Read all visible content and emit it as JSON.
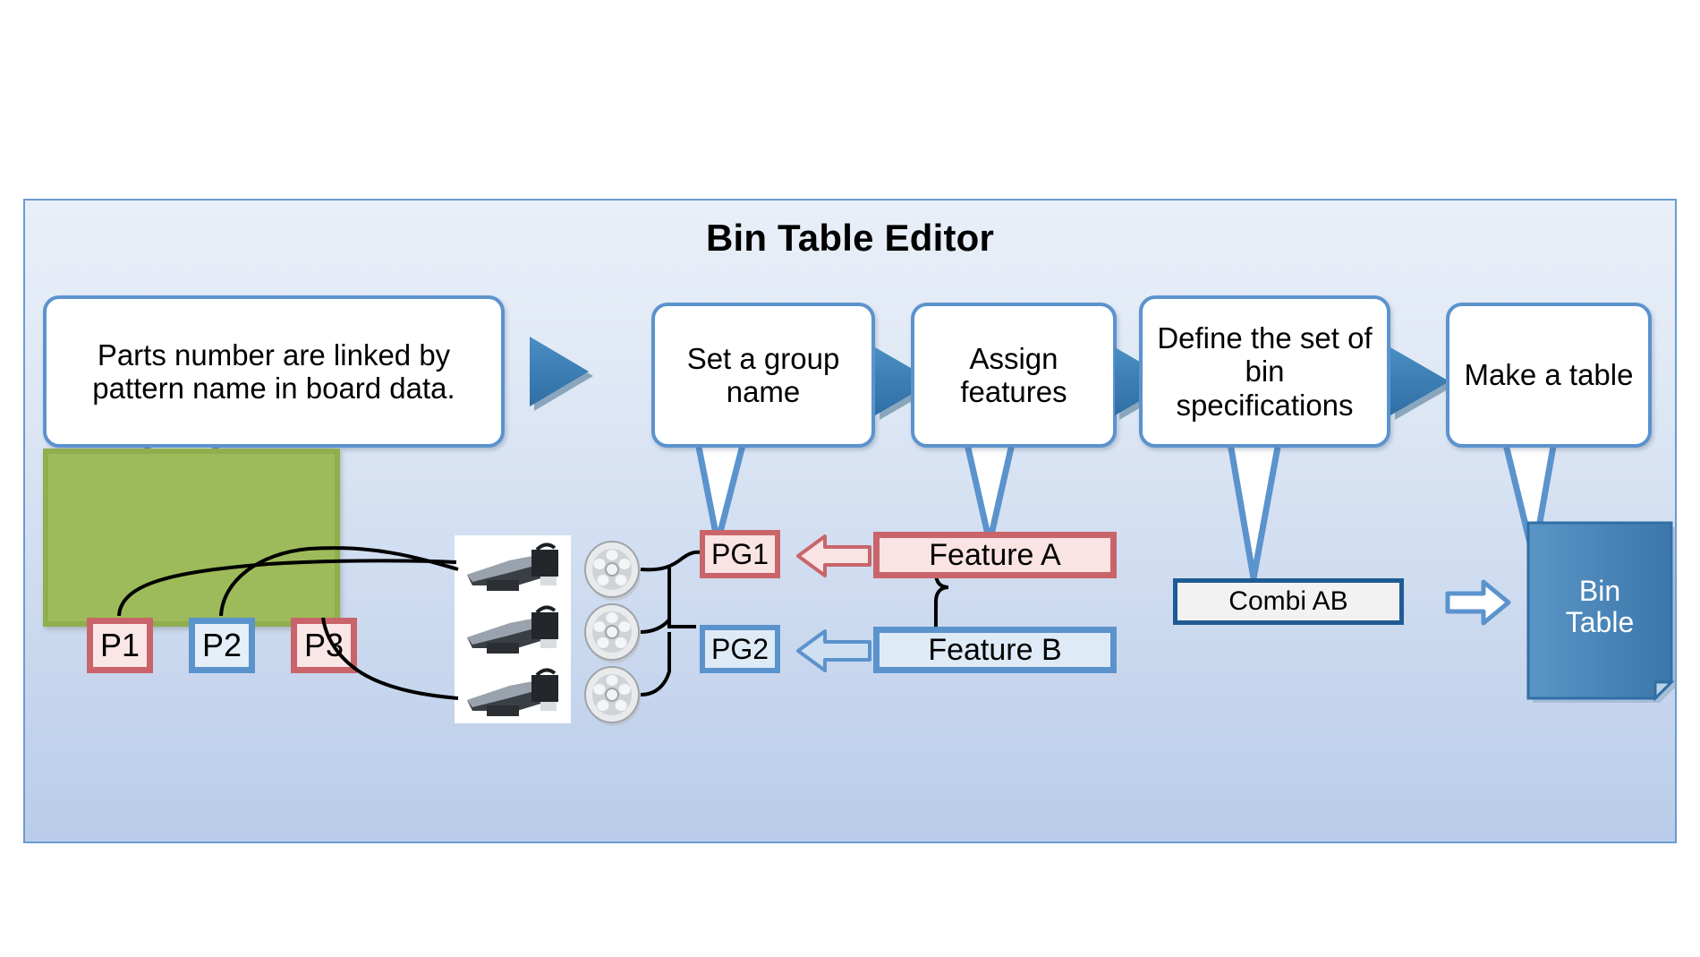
{
  "panel": {
    "title": "Bin Table Editor"
  },
  "callouts": [
    {
      "id": "parts-linked",
      "text": "Parts number are linked by pattern name in board data."
    },
    {
      "id": "set-group-name",
      "text": "Set a group name"
    },
    {
      "id": "assign-features",
      "text": "Assign features"
    },
    {
      "id": "define-bin-spec",
      "text": "Define the set of bin specifications"
    },
    {
      "id": "make-table",
      "text": "Make a table"
    }
  ],
  "board": {
    "parts": [
      {
        "label": "P1",
        "color": "red"
      },
      {
        "label": "P2",
        "color": "blue"
      },
      {
        "label": "P3",
        "color": "red"
      }
    ]
  },
  "groups": [
    {
      "label": "PG1",
      "color": "red"
    },
    {
      "label": "PG2",
      "color": "blue"
    }
  ],
  "features": [
    {
      "label": "Feature A",
      "color": "red"
    },
    {
      "label": "Feature B",
      "color": "blue"
    }
  ],
  "combi": {
    "label": "Combi AB"
  },
  "bin_table": {
    "line1": "Bin",
    "line2": "Table"
  },
  "icons": {
    "chevron": "chevron-right-icon",
    "block_arrow_left": "block-arrow-left-icon",
    "block_arrow_right": "block-arrow-right-icon",
    "brace": "curly-brace-icon",
    "component": "component-photo-icon",
    "reel": "tape-reel-icon"
  },
  "colors": {
    "panel_border": "#6b9bd2",
    "panel_bg_top": "#e9eff8",
    "panel_bg_bottom": "#b9cce9",
    "callout_border": "#5b93cd",
    "chevron_fill": "#3b7cb5",
    "board_green": "#9dbb5a",
    "red_accent": "#c9656a",
    "red_fill": "#f9e3e3",
    "blue_accent": "#5b93cd",
    "blue_fill": "#dfeaf7",
    "combi_border": "#1f5b94",
    "bin_table_fill": "#4a84b8"
  }
}
